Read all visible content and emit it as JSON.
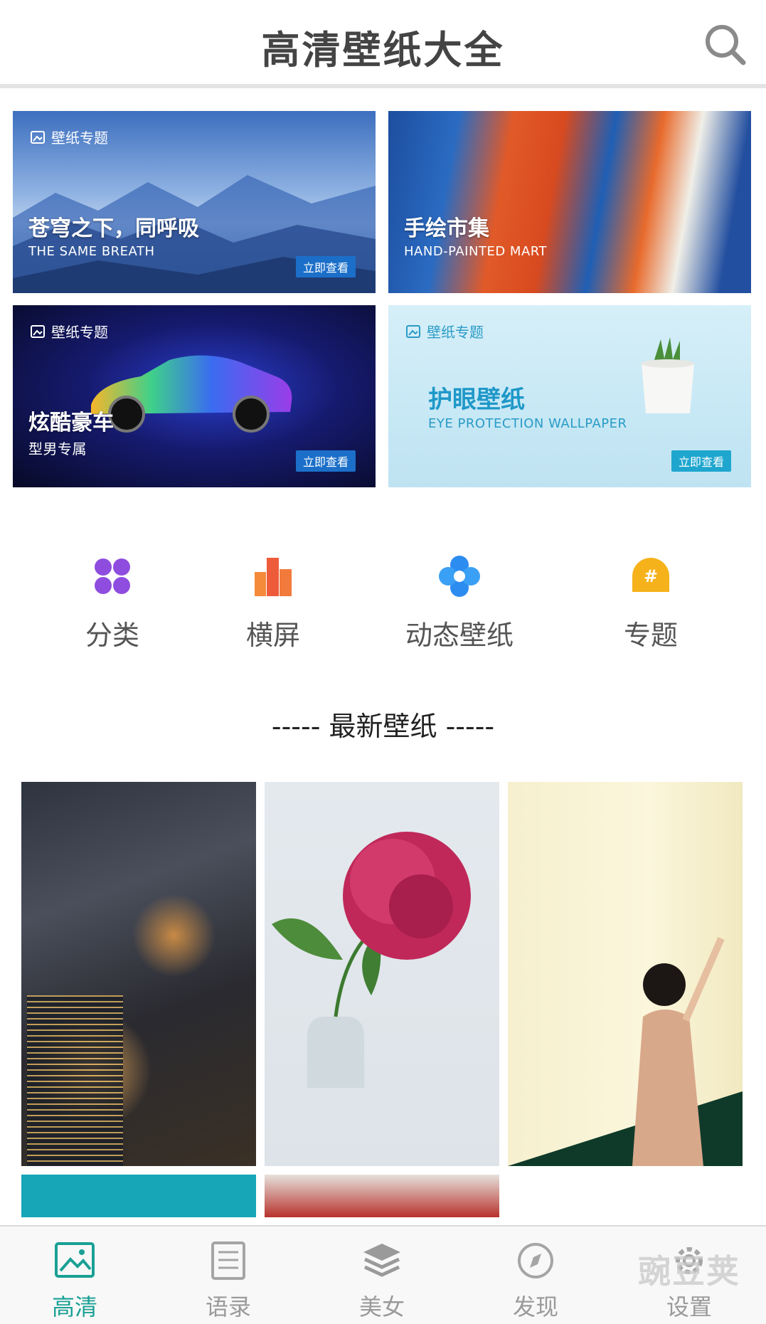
{
  "header": {
    "title": "高清壁纸大全",
    "search_icon": "search-icon"
  },
  "banners": [
    {
      "tag": "壁纸专题",
      "title": "苍穹之下，同呼吸",
      "subtitle": "THE SAME BREATH",
      "button": "立即查看"
    },
    {
      "tag": "",
      "title": "手绘市集",
      "subtitle": "HAND-PAINTED MART",
      "button": ""
    },
    {
      "tag": "壁纸专题",
      "title": "炫酷豪车",
      "subtitle": "型男专属",
      "button": "立即查看"
    },
    {
      "tag": "壁纸专题",
      "title": "护眼壁纸",
      "subtitle": "EYE PROTECTION WALLPAPER",
      "button": "立即查看"
    }
  ],
  "categories": [
    {
      "label": "分类",
      "icon": "grid-icon"
    },
    {
      "label": "横屏",
      "icon": "bars-icon"
    },
    {
      "label": "动态壁纸",
      "icon": "flower-icon"
    },
    {
      "label": "专题",
      "icon": "hashtag-icon"
    }
  ],
  "section_title": "----- 最新壁纸 -----",
  "tabs": [
    {
      "label": "高清",
      "icon": "image-icon",
      "active": true
    },
    {
      "label": "语录",
      "icon": "list-icon",
      "active": false
    },
    {
      "label": "美女",
      "icon": "layers-icon",
      "active": false
    },
    {
      "label": "发现",
      "icon": "compass-icon",
      "active": false
    },
    {
      "label": "设置",
      "icon": "gear-icon",
      "active": false
    }
  ],
  "watermark": "豌豆荚",
  "colors": {
    "accent": "#1aa095",
    "banner_button": "#1b6fc9",
    "eye_banner_text": "#1f98c8"
  }
}
